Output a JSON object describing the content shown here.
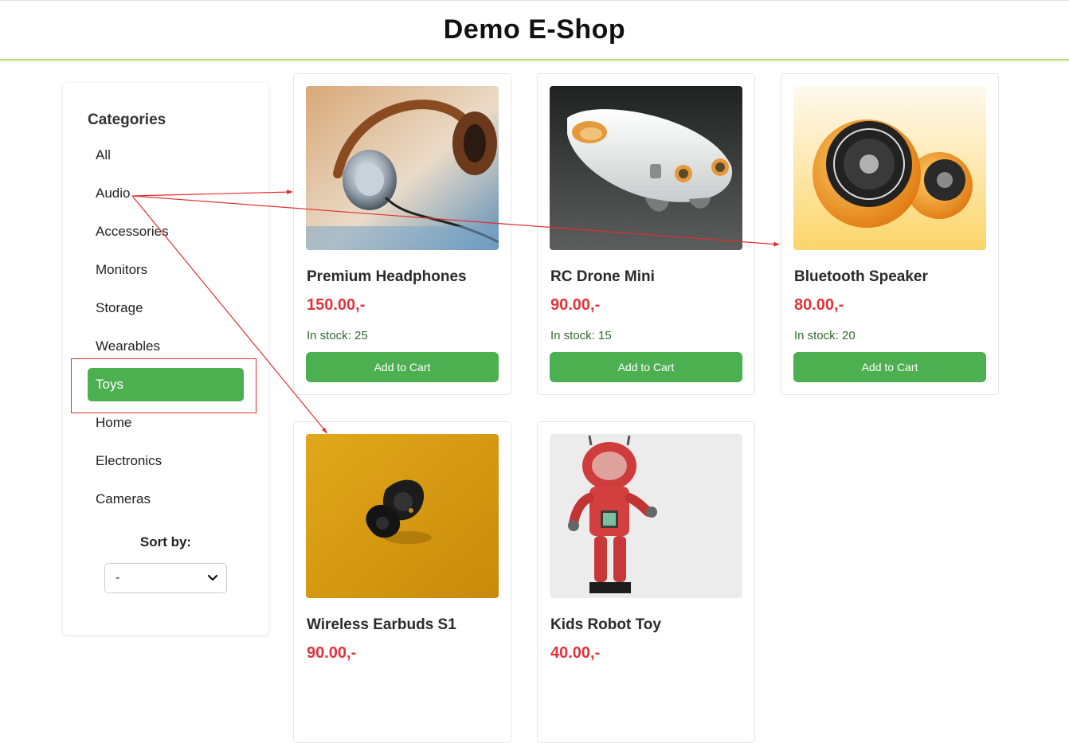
{
  "header": {
    "title": "Demo E-Shop"
  },
  "sidebar": {
    "title": "Categories",
    "categories": [
      {
        "label": "All",
        "active": false
      },
      {
        "label": "Audio",
        "active": false
      },
      {
        "label": "Accessories",
        "active": false
      },
      {
        "label": "Monitors",
        "active": false
      },
      {
        "label": "Storage",
        "active": false
      },
      {
        "label": "Wearables",
        "active": false
      },
      {
        "label": "Toys",
        "active": true
      },
      {
        "label": "Home",
        "active": false
      },
      {
        "label": "Electronics",
        "active": false
      },
      {
        "label": "Cameras",
        "active": false
      }
    ],
    "sort_label": "Sort by:",
    "sort_value": "-"
  },
  "products": [
    {
      "name": "Premium Headphones",
      "price": "150.00,-",
      "stock": "In stock: 25",
      "button": "Add to Cart",
      "image": "headphones"
    },
    {
      "name": "RC Drone Mini",
      "price": "90.00,-",
      "stock": "In stock: 15",
      "button": "Add to Cart",
      "image": "drone"
    },
    {
      "name": "Bluetooth Speaker",
      "price": "80.00,-",
      "stock": "In stock: 20",
      "button": "Add to Cart",
      "image": "speaker"
    },
    {
      "name": "Wireless Earbuds S1",
      "price": "90.00,-",
      "stock": "",
      "button": "",
      "image": "earbuds"
    },
    {
      "name": "Kids Robot Toy",
      "price": "40.00,-",
      "stock": "",
      "button": "",
      "image": "robot"
    }
  ],
  "colors": {
    "accent": "#4caf50",
    "price": "#e0343d",
    "stock": "#2e6b2e",
    "annotation": "#e03030",
    "header_line": "#b5e36a"
  }
}
